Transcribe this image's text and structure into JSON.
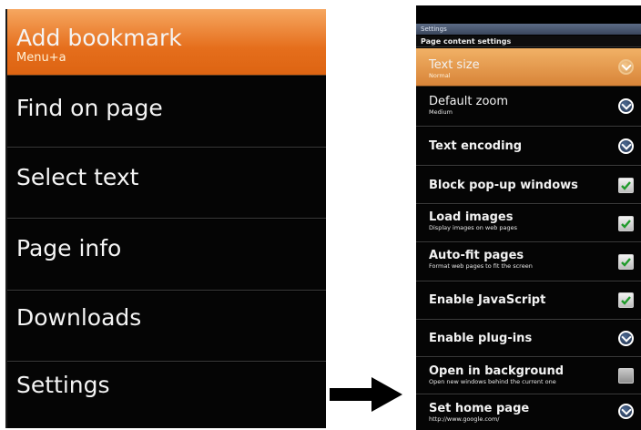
{
  "menu": {
    "items": [
      {
        "label": "Add bookmark",
        "shortcut": "Menu+a"
      },
      {
        "label": "Find on page"
      },
      {
        "label": "Select text"
      },
      {
        "label": "Page info"
      },
      {
        "label": "Downloads"
      },
      {
        "label": "Settings"
      }
    ]
  },
  "settings": {
    "title": "Settings",
    "section_header": "Page content settings",
    "rows": [
      {
        "title": "Text size",
        "summary": "Normal",
        "control": "chevron-icon"
      },
      {
        "title": "Default zoom",
        "summary": "Medium",
        "control": "chevron-icon"
      },
      {
        "title": "Text encoding",
        "control": "chevron-icon"
      },
      {
        "title": "Block pop-up windows",
        "control": "checkbox",
        "checked": true
      },
      {
        "title": "Load images",
        "summary": "Display images on web pages",
        "control": "checkbox",
        "checked": true
      },
      {
        "title": "Auto-fit pages",
        "summary": "Format web pages to fit the screen",
        "control": "checkbox",
        "checked": true
      },
      {
        "title": "Enable JavaScript",
        "control": "checkbox",
        "checked": true
      },
      {
        "title": "Enable plug-ins",
        "control": "chevron-icon"
      },
      {
        "title": "Open in background",
        "summary": "Open new windows behind the current one",
        "control": "checkbox",
        "checked": false
      },
      {
        "title": "Set home page",
        "summary": "http://www.google.com/",
        "control": "chevron-icon"
      }
    ]
  },
  "colors": {
    "highlight": "#e56e1c",
    "background": "#000000",
    "text": "#f4f4f4"
  },
  "icons": {
    "arrow": "arrow-right-icon"
  }
}
